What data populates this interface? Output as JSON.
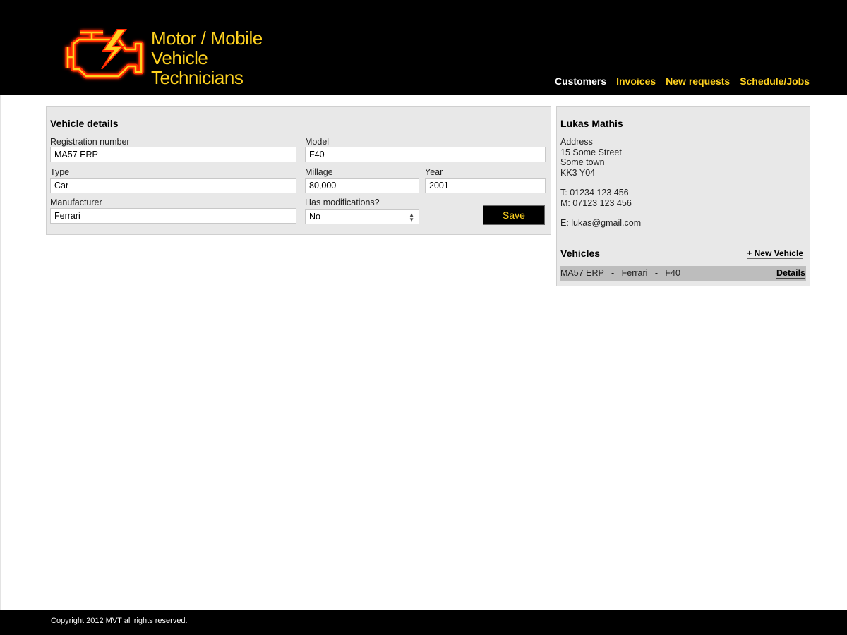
{
  "brand": {
    "line1": "Motor / Mobile",
    "line2": "Vehicle",
    "line3": "Technicians",
    "color": "#ffd21f"
  },
  "nav": {
    "customers": "Customers",
    "invoices": "Invoices",
    "new_requests": "New requests",
    "schedule": "Schedule/Jobs",
    "active": "Customers"
  },
  "vehicle": {
    "title": "Vehicle details",
    "reg_label": "Registration number",
    "reg_value": "MA57 ERP",
    "model_label": "Model",
    "model_value": "F40",
    "type_label": "Type",
    "type_value": "Car",
    "millage_label": "Millage",
    "millage_value": "80,000",
    "year_label": "Year",
    "year_value": "2001",
    "manufacturer_label": "Manufacturer",
    "manufacturer_value": "Ferrari",
    "mods_label": "Has modifications?",
    "mods_value": "No",
    "save_label": "Save"
  },
  "customer": {
    "name": "Lukas Mathis",
    "address_label": "Address",
    "address1": "15 Some Street",
    "address2": "Some town",
    "postcode": "KK3 Y04",
    "tel": "T: 01234 123 456",
    "mobile": "M: 07123 123 456",
    "email": "E: lukas@gmail.com",
    "vehicles_title": "Vehicles",
    "new_vehicle_label": "+ New Vehicle",
    "vehicles": [
      {
        "summary": "MA57 ERP   -   Ferrari   -   F40",
        "details_label": "Details"
      }
    ]
  },
  "footer": {
    "copyright": "Copyright 2012 MVT all rights reserved."
  },
  "icons": {
    "logo": "check-engine-icon"
  }
}
